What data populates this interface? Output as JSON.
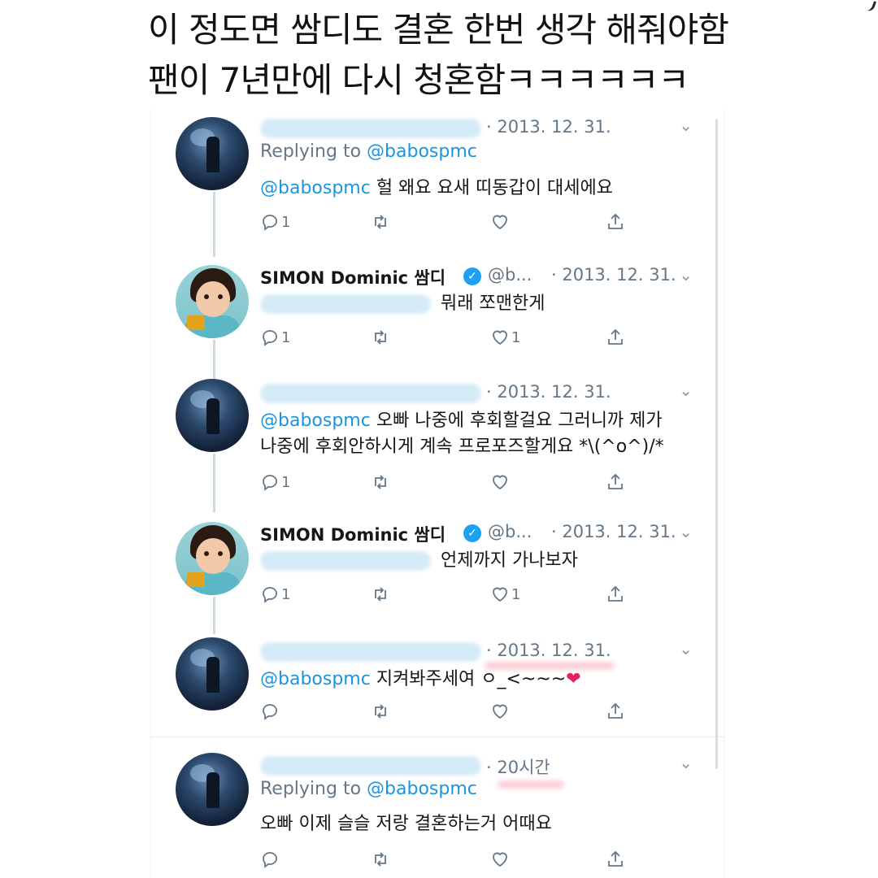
{
  "caption": {
    "line1": "이 정도면 쌈디도 결혼 한번 생각 해줘야함",
    "line2": "팬이 7년만에 다시 청혼함ㅋㅋㅋㅋㅋㅋ"
  },
  "tweets": [
    {
      "date": "· 2013. 12. 31.",
      "replying_label": "Replying to",
      "replying_handle": "@babospmc",
      "mention": "@babospmc",
      "text": "헐 왜요 요새 띠동갑이 대세에요",
      "reply_count": "1",
      "like_count": ""
    },
    {
      "name": "SIMON Dominic 쌈디",
      "handle": "@b...",
      "date": "· 2013. 12. 31.",
      "text": "뭐래 쪼맨한게",
      "reply_count": "1",
      "like_count": "1"
    },
    {
      "date": "· 2013. 12. 31.",
      "mention": "@babospmc",
      "text_line1": "오빠 나중에 후회할걸요 그러니까 제가",
      "text_line2": "나중에 후회안하시게 계속 프로포즈할게요 *\\(^o^)/*",
      "reply_count": "1",
      "like_count": ""
    },
    {
      "name": "SIMON Dominic 쌈디",
      "handle": "@b...",
      "date": "· 2013. 12. 31.",
      "text": "언제까지 가나보자",
      "reply_count": "1",
      "like_count": "1"
    },
    {
      "date": "· 2013. 12. 31.",
      "mention": "@babospmc",
      "text": "지켜봐주세여 ㅇ_<~~~",
      "emoji": "❤",
      "reply_count": "",
      "like_count": ""
    },
    {
      "date": "· 20시간",
      "replying_label": "Replying to",
      "replying_handle": "@babospmc",
      "text": "오빠 이제 슬슬 저랑 결혼하는거 어때요",
      "reply_count": "",
      "like_count": ""
    }
  ],
  "icons": {
    "reply": "reply-icon",
    "retweet": "retweet-icon",
    "like": "heart-icon",
    "share": "share-icon",
    "more": "chevron-down-icon",
    "verified": "verified-badge-icon"
  },
  "colors": {
    "link": "#1b95e0",
    "verified": "#1da1f2",
    "muted": "#657786",
    "highlight": "#f7a8b8"
  }
}
